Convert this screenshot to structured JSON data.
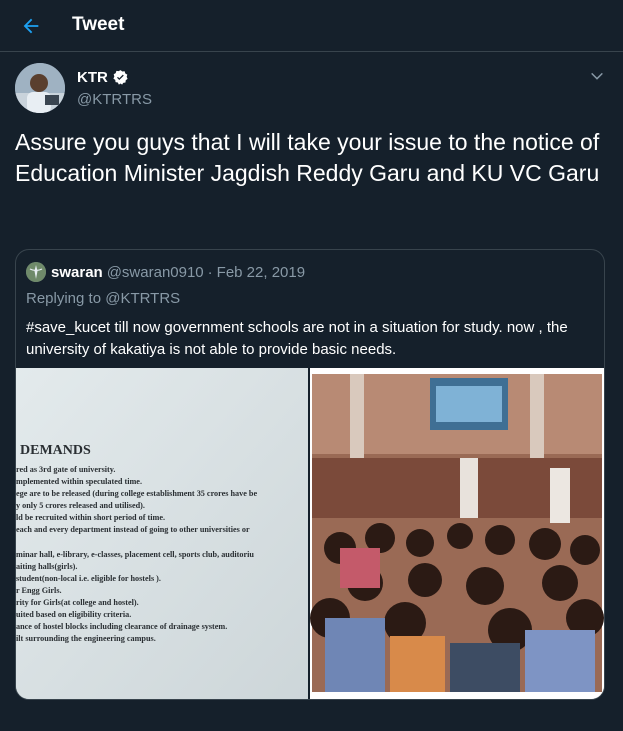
{
  "header": {
    "title": "Tweet"
  },
  "tweet": {
    "author_name": "KTR",
    "author_handle": "@KTRTRS",
    "text": "Assure you guys that I will take your issue to the notice of Education Minister Jagdish Reddy Garu and KU VC Garu"
  },
  "quote": {
    "author_name": "swaran",
    "author_handle": "@swaran0910",
    "separator": "·",
    "date": "Feb 22, 2019",
    "reply_prefix": "Replying to",
    "reply_to": "@KTRTRS",
    "text": "#save_kucet   till now government schools are not in a situation for study. now , the university of kakatiya is not able to provide basic needs."
  },
  "document_image": {
    "heading": "DEMANDS",
    "lines": [
      "red as 3rd gate of university.",
      "mplemented within speculated time.",
      "ege are to be released (during college establishment 35 crores have be",
      "y only 5 crores released and utilised).",
      "ld be recruited within short period of time.",
      "each and every department instead of going to other universities or",
      "minar hall, e-library, e-classes, placement cell, sports club, auditoriu",
      "aiting halls(girls).",
      "student(non-local i.e. eligible for hostels ).",
      "r Engg Girls.",
      "rity for Girls(at college and hostel).",
      "uited based on eligibility criteria.",
      "ance of hostel blocks including clearance of drainage system.",
      "ilt surrounding the engineering campus."
    ]
  },
  "colors": {
    "background": "#15202b",
    "border": "#38444d",
    "accent": "#1da1f2",
    "secondary_text": "#8899a6"
  },
  "icons": [
    "back-arrow-icon",
    "verified-badge-icon",
    "chevron-down-icon"
  ]
}
